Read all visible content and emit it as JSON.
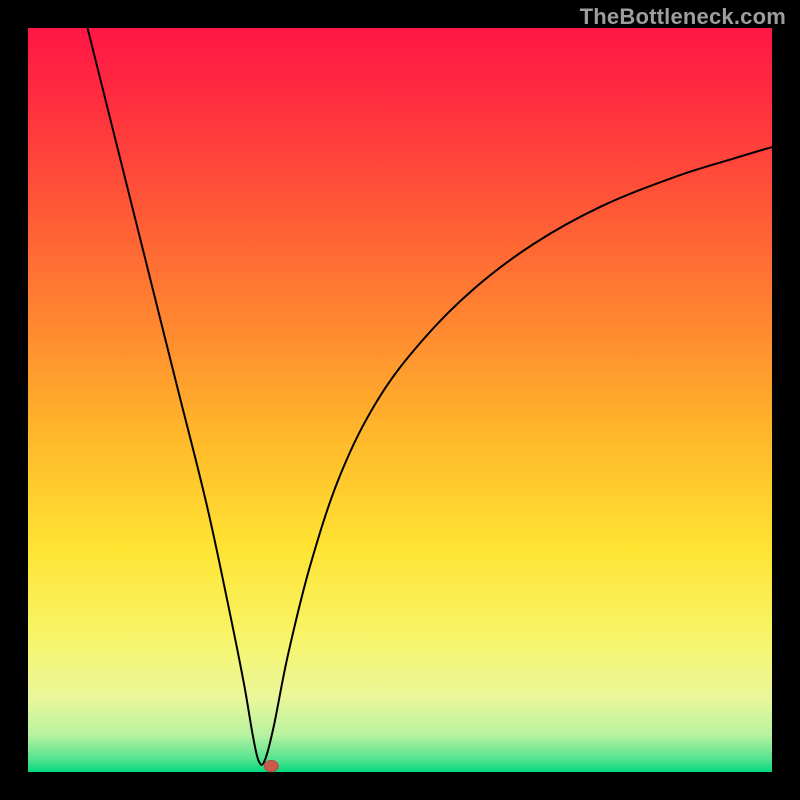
{
  "watermark": "TheBottleneck.com",
  "colors": {
    "frame": "#000000",
    "curve": "#000000",
    "marker_fill": "#cc5a4a",
    "marker_stroke": "#b34a3c",
    "gradient_stops": [
      {
        "offset": 0.0,
        "color": "#ff1746"
      },
      {
        "offset": 0.1,
        "color": "#ff2e3f"
      },
      {
        "offset": 0.25,
        "color": "#ff5a36"
      },
      {
        "offset": 0.4,
        "color": "#ff8830"
      },
      {
        "offset": 0.55,
        "color": "#ffb82a"
      },
      {
        "offset": 0.7,
        "color": "#ffe433"
      },
      {
        "offset": 0.82,
        "color": "#f7f56a"
      },
      {
        "offset": 0.9,
        "color": "#eaf79a"
      },
      {
        "offset": 0.95,
        "color": "#b8f2a0"
      },
      {
        "offset": 0.985,
        "color": "#4de28f"
      },
      {
        "offset": 1.0,
        "color": "#00d87e"
      }
    ]
  },
  "chart_data": {
    "type": "line",
    "title": "",
    "xlabel": "",
    "ylabel": "",
    "xlim": [
      0,
      100
    ],
    "ylim": [
      0,
      100
    ],
    "grid": false,
    "legend": false,
    "notch_x": 31,
    "marker": {
      "x": 32.7,
      "y": 0.8
    },
    "series": [
      {
        "name": "curve",
        "x": [
          8,
          12,
          16,
          20,
          24,
          27,
          29,
          30.2,
          31,
          31.8,
          33,
          35,
          38,
          42,
          47,
          53,
          60,
          68,
          77,
          87,
          95,
          100
        ],
        "y": [
          100,
          84,
          68,
          52,
          36,
          22,
          12,
          5,
          1.5,
          1.5,
          6,
          16,
          28,
          40,
          50,
          58,
          65,
          71,
          76,
          80,
          82.5,
          84
        ]
      }
    ]
  }
}
